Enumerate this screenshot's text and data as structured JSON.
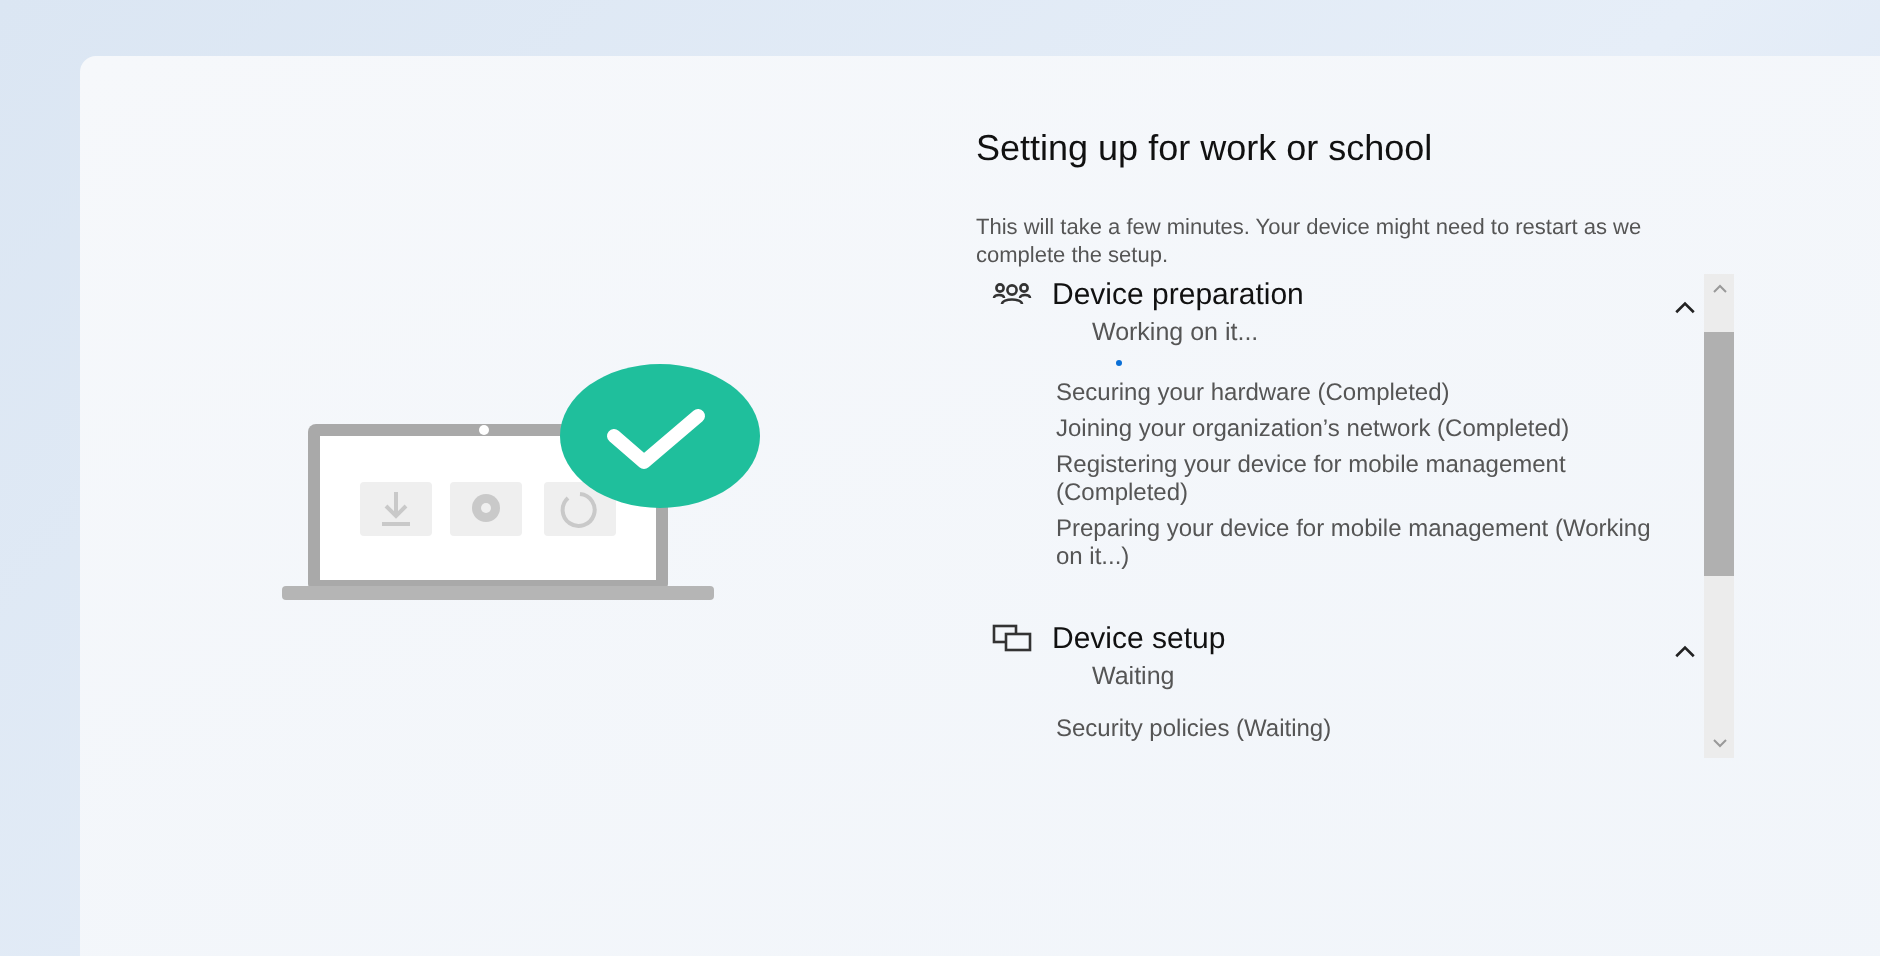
{
  "title": "Setting up for work or school",
  "description": "This will take a few minutes. Your device might need to restart as we complete the setup.",
  "sections": [
    {
      "kind": "people",
      "title": "Device preparation",
      "status": "Working on it...",
      "in_progress": true,
      "expanded": true,
      "steps": [
        "Securing your hardware (Completed)",
        "Joining your organization’s network (Completed)",
        "Registering your device for mobile management (Completed)",
        "Preparing your device for mobile management (Working on it...)"
      ]
    },
    {
      "kind": "devices",
      "title": "Device setup",
      "status": "Waiting",
      "in_progress": false,
      "expanded": true,
      "steps": [
        "Security policies (Waiting)"
      ]
    }
  ]
}
